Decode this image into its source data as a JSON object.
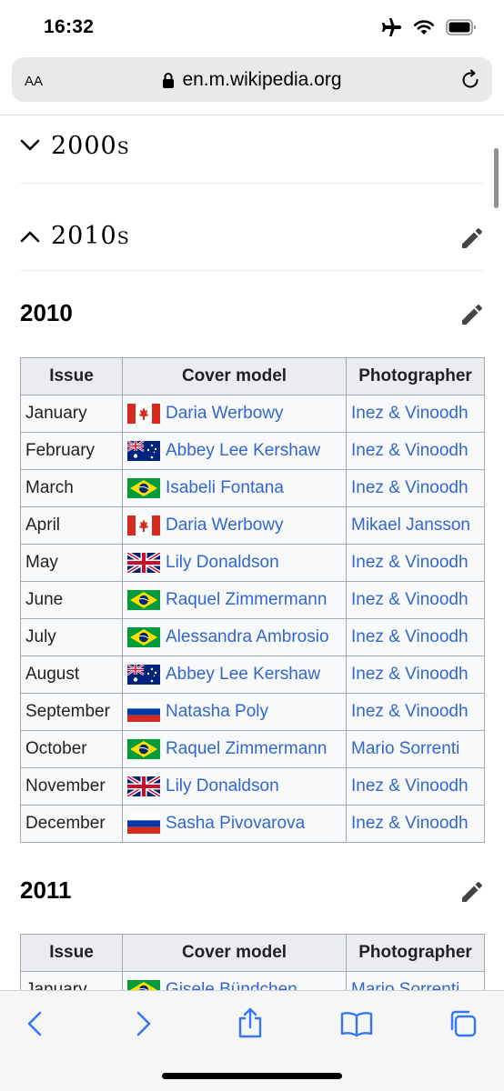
{
  "status": {
    "time": "16:32"
  },
  "browser": {
    "aa_label": "AA",
    "url": "en.m.wikipedia.org",
    "icons": [
      "airplane-icon",
      "wifi-icon",
      "battery-icon",
      "lock-icon",
      "reload-icon"
    ]
  },
  "sections": [
    {
      "label": "2000s",
      "expanded": false
    },
    {
      "label": "2010s",
      "expanded": true
    }
  ],
  "headers": [
    "Issue",
    "Cover model",
    "Photographer"
  ],
  "years": [
    {
      "year": "2010",
      "rows": [
        {
          "issue": "January",
          "flag": "canada",
          "model": "Daria Werbowy",
          "photographer": "Inez & Vinoodh"
        },
        {
          "issue": "February",
          "flag": "australia",
          "model": "Abbey Lee Kershaw",
          "photographer": "Inez & Vinoodh"
        },
        {
          "issue": "March",
          "flag": "brazil",
          "model": "Isabeli Fontana",
          "photographer": "Inez & Vinoodh"
        },
        {
          "issue": "April",
          "flag": "canada",
          "model": "Daria Werbowy",
          "photographer": "Mikael Jansson"
        },
        {
          "issue": "May",
          "flag": "uk",
          "model": "Lily Donaldson",
          "photographer": "Inez & Vinoodh"
        },
        {
          "issue": "June",
          "flag": "brazil",
          "model": "Raquel Zimmermann",
          "photographer": "Inez & Vinoodh"
        },
        {
          "issue": "July",
          "flag": "brazil",
          "model": "Alessandra Ambrosio",
          "photographer": "Inez & Vinoodh"
        },
        {
          "issue": "August",
          "flag": "australia",
          "model": "Abbey Lee Kershaw",
          "photographer": "Inez & Vinoodh"
        },
        {
          "issue": "September",
          "flag": "russia",
          "model": "Natasha Poly",
          "photographer": "Inez & Vinoodh"
        },
        {
          "issue": "October",
          "flag": "brazil",
          "model": "Raquel Zimmermann",
          "photographer": "Mario Sorrenti"
        },
        {
          "issue": "November",
          "flag": "uk",
          "model": "Lily Donaldson",
          "photographer": "Inez & Vinoodh"
        },
        {
          "issue": "December",
          "flag": "russia",
          "model": "Sasha Pivovarova",
          "photographer": "Inez & Vinoodh"
        }
      ]
    },
    {
      "year": "2011",
      "rows": [
        {
          "issue": "January",
          "flag": "brazil",
          "model": "Gisele Bündchen",
          "photographer": "Mario Sorrenti"
        }
      ]
    }
  ],
  "toolbar": {
    "icons": [
      "back-icon",
      "forward-icon",
      "share-icon",
      "bookmarks-icon",
      "tabs-icon"
    ]
  },
  "colors": {
    "link": "#3366cc",
    "header_bg": "#eaecf0",
    "cell_bg": "#f8f9fa",
    "border": "#a2a9b1"
  }
}
